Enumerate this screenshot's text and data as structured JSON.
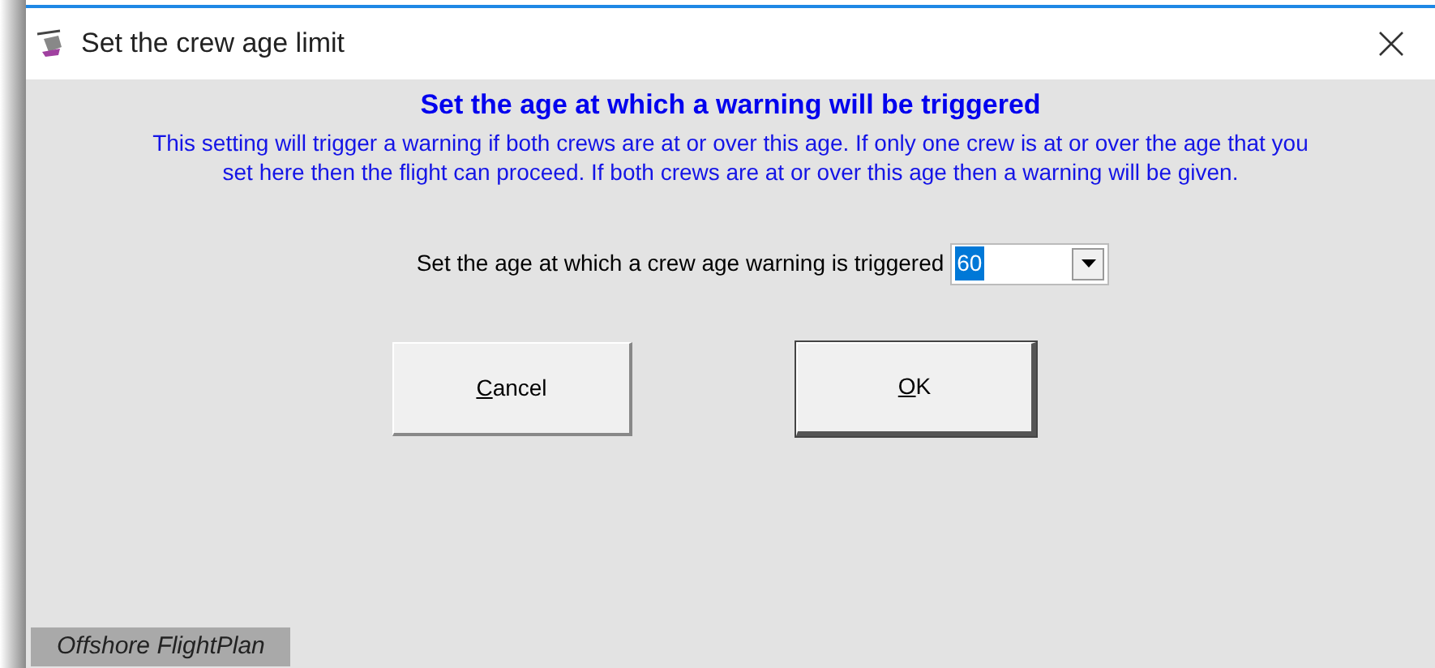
{
  "window": {
    "title": "Set the crew age limit"
  },
  "heading": "Set the age at which a warning will be triggered",
  "description": "This setting will trigger a warning if both crews are at or over this age. If only one crew is at or over the age that you set here then the flight can proceed. If both crews are at or over this age then a warning will be given.",
  "age_setting": {
    "label": "Set the age at which a crew age warning is triggered",
    "value": "60",
    "text_selected": true
  },
  "buttons": [
    {
      "label": "Cancel",
      "access_key_underlined": true,
      "default": false
    },
    {
      "label": "OK",
      "access_key_underlined": true,
      "default": true
    }
  ],
  "footer": "Offshore FlightPlan"
}
